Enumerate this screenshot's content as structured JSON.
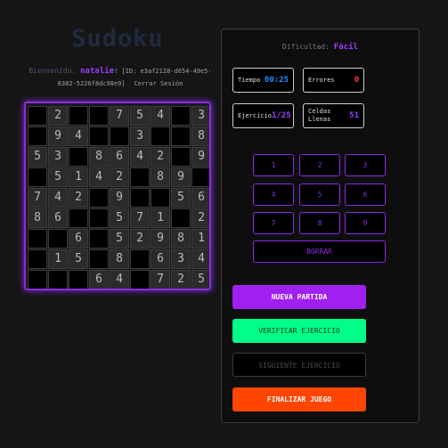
{
  "app": {
    "title": "Sudoku"
  },
  "welcome": {
    "prefix": "Bienvenido, ",
    "username": "natalie",
    "id_label": "! [ID: e3af2128-d654-49e5-8382-5226f8dc98e9]",
    "logout": "Cerrar Sesión"
  },
  "board": {
    "rows": [
      [
        "",
        "2",
        "",
        "",
        "7",
        "5",
        "4",
        "",
        "3"
      ],
      [
        "",
        "9",
        "4",
        "",
        "",
        "3",
        "",
        "",
        "8"
      ],
      [
        "5",
        "3",
        "",
        "8",
        "6",
        "4",
        "2",
        "",
        "9"
      ],
      [
        "",
        "5",
        "1",
        "4",
        "2",
        "",
        "8",
        "9",
        ""
      ],
      [
        "7",
        "4",
        "2",
        "",
        "9",
        "",
        "",
        "5",
        "6"
      ],
      [
        "8",
        "6",
        "",
        "",
        "5",
        "7",
        "1",
        "",
        "2"
      ],
      [
        "",
        "",
        "6",
        "",
        "5",
        "2",
        "9",
        "8",
        "1"
      ],
      [
        "",
        "1",
        "5",
        "",
        "8",
        "",
        "6",
        "3",
        "4"
      ],
      [
        "",
        "",
        "",
        "6",
        "4",
        "",
        "7",
        "2",
        "5"
      ]
    ]
  },
  "panel": {
    "difficulty_label": "Dificultad: ",
    "difficulty_value": "Fácil",
    "stats": {
      "time_label": "Tiempo",
      "time_value": "00:25",
      "errors_label": "Errores",
      "errors_value": "0",
      "exercise_label": "Ejercicio",
      "exercise_value": "1/25",
      "filled_label": "Celdas Llenas",
      "filled_value": "51"
    },
    "numpad": [
      "1",
      "2",
      "3",
      "4",
      "5",
      "6",
      "7",
      "8",
      "9"
    ],
    "erase_label": "BORRAR",
    "buttons": {
      "new_game": "NUEVA PARTIDA",
      "verify": "VERIFICAR EJERCICIO",
      "next": "SIGUIENTE EJERCICIO",
      "finish": "FINALIZAR JUEGO"
    }
  },
  "colors": {
    "accent": "#8a2be2",
    "verify": "#00ff88",
    "finish": "#ff4500"
  }
}
